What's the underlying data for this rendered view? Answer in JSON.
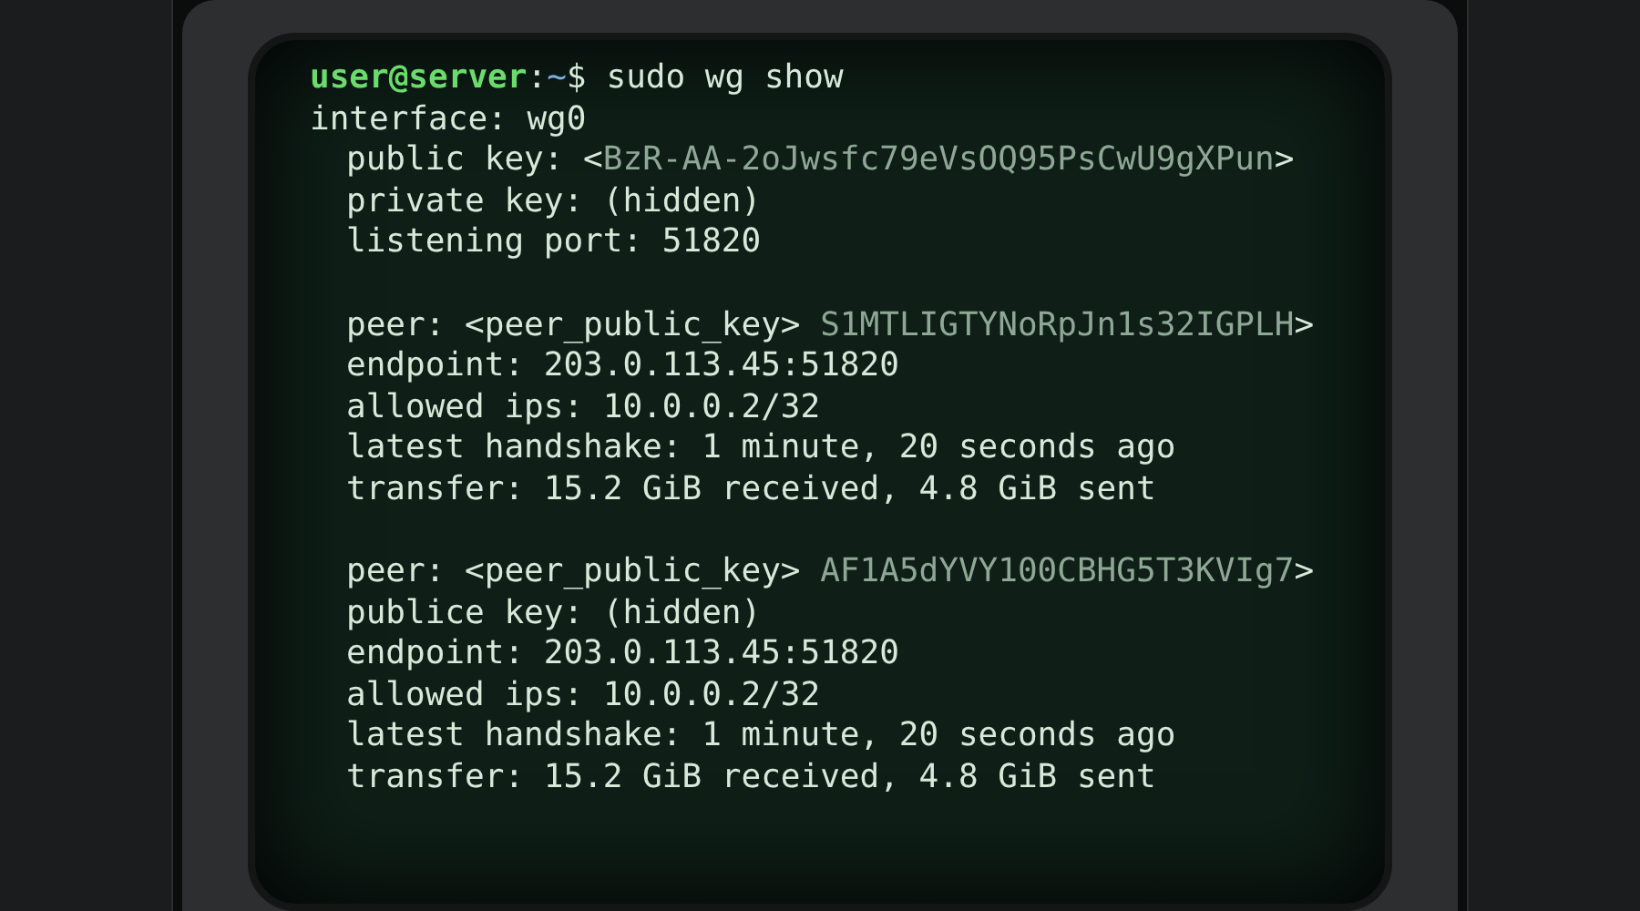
{
  "prompt": {
    "user": "user@server",
    "sep": ":",
    "path": "~",
    "symbol": "$",
    "command": "sudo wg show"
  },
  "output": {
    "text": "interface: wg0",
    "blocks": [
      {
        "lines": [
          {
            "text": "public key: <",
            "secret": "BzR-AA-2oJwsfc79eVsOQ95PsCwU9gXPun",
            "tail": ">"
          },
          {
            "text": "private key: (hidden)"
          },
          {
            "text": "listening port: 51820"
          }
        ]
      },
      {
        "lines": [
          {
            "text": "peer: <peer_public_key> ",
            "secret": "S1MTLIGTYNoRpJn1s32IGPLH",
            "tail": ">"
          },
          {
            "text": "endpoint: 203.0.113.45:51820"
          },
          {
            "text": "allowed ips: 10.0.0.2/32"
          },
          {
            "text": "latest handshake: 1 minute, 20 seconds ago"
          },
          {
            "text": "transfer: 15.2 GiB received, 4.8 GiB sent"
          }
        ]
      },
      {
        "lines": [
          {
            "text": "peer: <peer_public_key> ",
            "secret": "AF1A5dYVY100CBHG5T3KVIg7",
            "tail": ">"
          },
          {
            "text": "publice key: (hidden)"
          },
          {
            "text": "endpoint: 203.0.113.45:51820"
          },
          {
            "text": "allowed ips: 10.0.0.2/32"
          },
          {
            "text": "latest handshake: 1 minute, 20 seconds ago"
          },
          {
            "text": "transfer: 15.2 GiB received, 4.8 GiB sent"
          }
        ]
      }
    ]
  }
}
